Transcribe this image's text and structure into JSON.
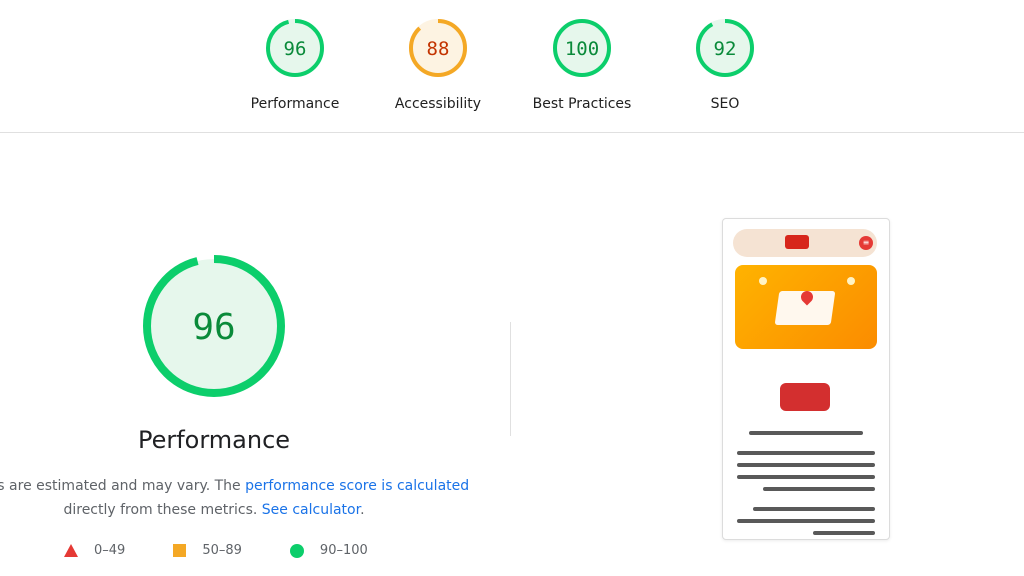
{
  "categories": [
    {
      "label": "Performance",
      "score": 96,
      "status": "pass"
    },
    {
      "label": "Accessibility",
      "score": 88,
      "status": "average"
    },
    {
      "label": "Best Practices",
      "score": 100,
      "status": "pass"
    },
    {
      "label": "SEO",
      "score": 92,
      "status": "pass"
    }
  ],
  "main": {
    "score": 96,
    "title": "Performance",
    "desc_prefix": "Values are estimated and may vary. The ",
    "desc_link1": "performance score is calculated",
    "desc_middle": " directly from these metrics. ",
    "desc_link2": "See calculator",
    "desc_suffix": "."
  },
  "legend": [
    {
      "icon": "triangle-icon",
      "label": "0–49",
      "color": "#e53935"
    },
    {
      "icon": "square-icon",
      "label": "50–89",
      "color": "#f4a825"
    },
    {
      "icon": "circle-icon",
      "label": "90–100",
      "color": "#0cce6b"
    }
  ],
  "colors": {
    "pass": "#0cce6b",
    "pass_fill": "#e6f7ec",
    "pass_text": "#0a8a3a",
    "average": "#f4a825",
    "average_fill": "#fdf3e2",
    "average_text": "#c33300",
    "link": "#1a73e8"
  },
  "screenshot": {
    "menu_icon": "menu-icon"
  }
}
